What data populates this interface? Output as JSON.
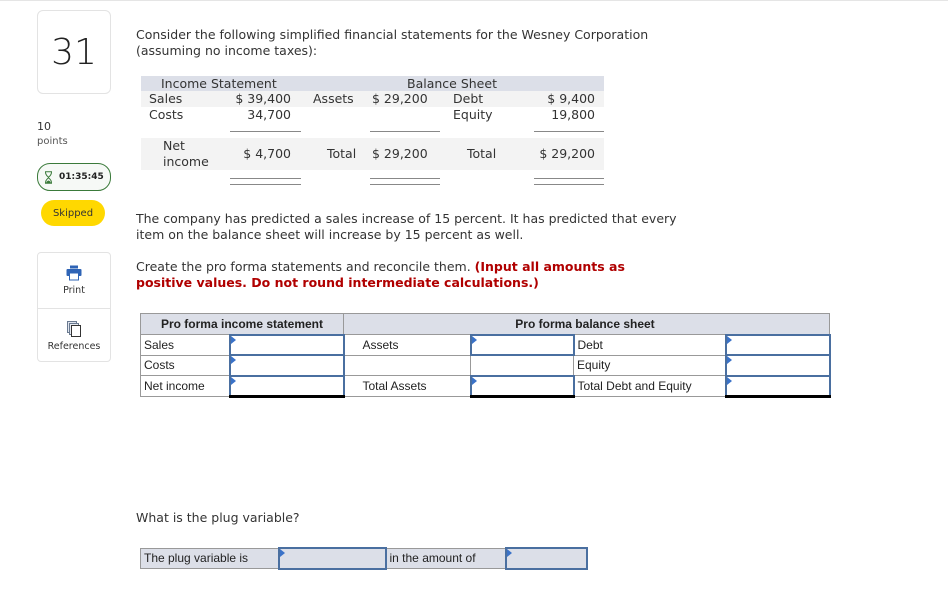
{
  "sidebar": {
    "question_number": "31",
    "points_value": "10",
    "points_label": "points",
    "timer": "01:35:45",
    "status_badge": "Skipped",
    "tools": [
      {
        "label": "Print",
        "icon": "printer-icon"
      },
      {
        "label": "References",
        "icon": "references-icon"
      }
    ]
  },
  "question": {
    "intro": "Consider the following simplified financial statements for the Wesney Corporation (assuming no income taxes):",
    "given": {
      "income_statement_title": "Income Statement",
      "balance_sheet_title": "Balance Sheet",
      "sales_label": "Sales",
      "sales_value": "$ 39,400",
      "costs_label": "Costs",
      "costs_value": "34,700",
      "net_income_label_1": "Net",
      "net_income_label_2": "income",
      "net_income_value": "$ 4,700",
      "assets_label": "Assets",
      "assets_value": "$ 29,200",
      "assets_total_label": "Total",
      "assets_total_value": "$ 29,200",
      "debt_label": "Debt",
      "debt_value": "$ 9,400",
      "equity_label": "Equity",
      "equity_value": "19,800",
      "de_total_label": "Total",
      "de_total_value": "$ 29,200"
    },
    "prediction": "The company has predicted a sales increase of 15 percent. It has predicted that every item on the balance sheet will increase by 15 percent as well.",
    "instruction": "Create the pro forma statements and reconcile them. ",
    "instruction_bold": "(Input all amounts as positive values. Do not round intermediate calculations.)",
    "plug_question": "What is the plug variable?"
  },
  "pro_forma": {
    "income_title": "Pro forma income statement",
    "balance_title": "Pro forma balance sheet",
    "income_rows": [
      {
        "label": "Sales",
        "value": ""
      },
      {
        "label": "Costs",
        "value": ""
      },
      {
        "label": "Net income",
        "value": ""
      }
    ],
    "assets_rows": [
      {
        "label": "Assets",
        "value": ""
      },
      {
        "label": "",
        "value": null
      },
      {
        "label": "Total Assets",
        "value": ""
      }
    ],
    "liab_rows": [
      {
        "label": "Debt",
        "value": ""
      },
      {
        "label": "Equity",
        "value": ""
      },
      {
        "label": "Total Debt and Equity",
        "value": ""
      }
    ]
  },
  "plug": {
    "label": "The plug variable is",
    "value": "",
    "amount_label": "in the amount of",
    "amount_value": ""
  }
}
